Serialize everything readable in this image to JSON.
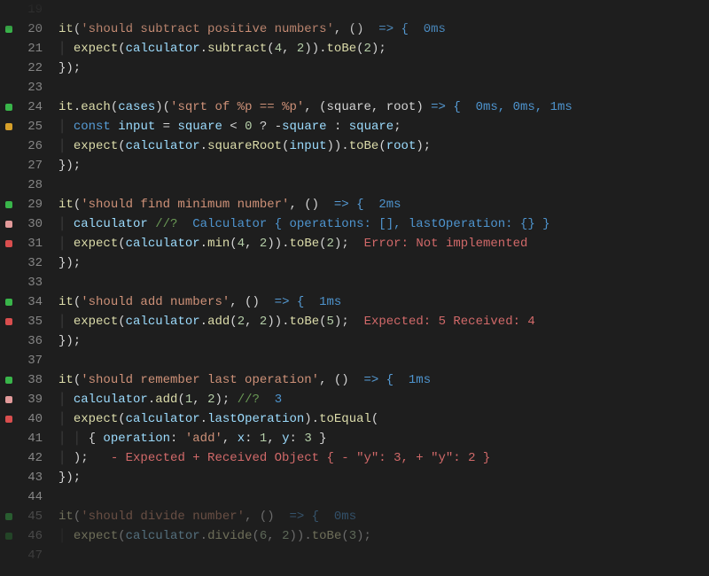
{
  "editor": {
    "language": "javascript-jest",
    "first_line": 19,
    "timings": {
      "subtract": "0ms",
      "sqrt": "0ms, 0ms, 1ms",
      "minimum": "2ms",
      "add": "1ms",
      "last_op": "1ms",
      "divide": "0ms"
    },
    "quokka": {
      "calculator_value": "Calculator { operations: [], lastOperation: {} }",
      "add12_value": "3"
    },
    "errors": {
      "min": "Error: Not implemented",
      "add": "Expected: 5 Received: 4",
      "last_op": "- Expected + Received Object { - \"y\": 3, + \"y\": 2 }"
    },
    "tests": {
      "subtract": {
        "title": "'should subtract positive numbers'",
        "expectA": "4",
        "expectB": "2",
        "toBe": "2",
        "method": "subtract"
      },
      "sqrt_each": {
        "pattern": "'sqrt of %p == %p'",
        "params": "(square, root)",
        "method": "squareRoot"
      },
      "minimum": {
        "title": "'should find minimum number'",
        "expectA": "4",
        "expectB": "2",
        "toBe": "2",
        "method": "min"
      },
      "add": {
        "title": "'should add numbers'",
        "expectA": "2",
        "expectB": "2",
        "toBe": "5",
        "method": "add"
      },
      "last_op": {
        "title": "'should remember last operation'",
        "callA": "1",
        "callB": "2",
        "expected_obj": "{ operation: 'add', x: 1, y: 3 }"
      },
      "divide": {
        "title": "'should divide number'",
        "expectA": "6",
        "expectB": "2",
        "toBe": "3",
        "method": "divide"
      }
    },
    "syntax": {
      "it": "it",
      "each": "each",
      "cases": "cases",
      "arrow": " => {",
      "close": "});",
      "expect": "expect",
      "calculator": "calculator",
      "toBe": "toBe",
      "toEqual": "toEqual",
      "const": "const",
      "input": "input",
      "square": "square",
      "root": "root",
      "lastOperation": "lastOperation",
      "quokka_marker": "//?"
    },
    "line_numbers": [
      "19",
      "20",
      "21",
      "22",
      "23",
      "24",
      "25",
      "26",
      "27",
      "28",
      "29",
      "30",
      "31",
      "32",
      "33",
      "34",
      "35",
      "36",
      "37",
      "38",
      "39",
      "40",
      "41",
      "42",
      "43",
      "44",
      "45",
      "46",
      "47"
    ]
  }
}
